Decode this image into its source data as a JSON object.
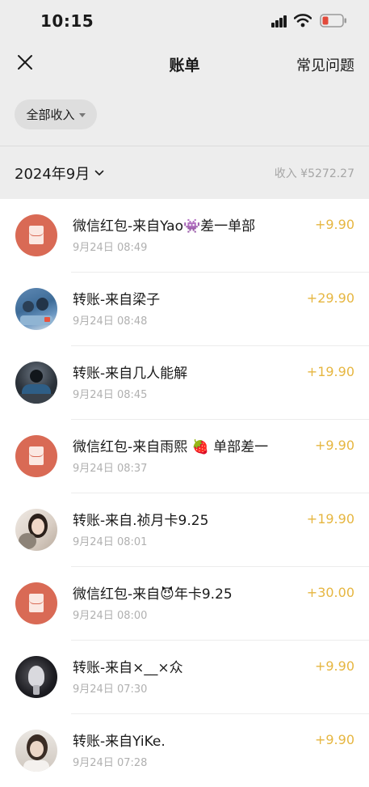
{
  "status_bar": {
    "time": "10:15"
  },
  "nav": {
    "title": "账单",
    "faq_label": "常见问题"
  },
  "filter": {
    "label": "全部收入"
  },
  "month": {
    "label": "2024年9月",
    "income_summary": "收入 ¥5272.27"
  },
  "transactions": [
    {
      "title": "微信红包-来自Yao👾差一单部",
      "time": "9月24日 08:49",
      "amount": "+9.90",
      "avatar": "red-packet-icon"
    },
    {
      "title": "转账-来自梁子",
      "time": "9月24日 08:48",
      "amount": "+29.90",
      "avatar": "user-avatar"
    },
    {
      "title": "转账-来自几人能解",
      "time": "9月24日 08:45",
      "amount": "+19.90",
      "avatar": "user-avatar"
    },
    {
      "title": "微信红包-来自雨熙 🍓 单部差一",
      "time": "9月24日 08:37",
      "amount": "+9.90",
      "avatar": "red-packet-icon"
    },
    {
      "title": "转账-来自.祯月卡9.25",
      "time": "9月24日 08:01",
      "amount": "+19.90",
      "avatar": "user-avatar"
    },
    {
      "title": "微信红包-来自😈年卡9.25",
      "time": "9月24日 08:00",
      "amount": "+30.00",
      "avatar": "red-packet-icon"
    },
    {
      "title": "转账-来自×__×众",
      "time": "9月24日 07:30",
      "amount": "+9.90",
      "avatar": "user-avatar"
    },
    {
      "title": "转账-来自YiKe.",
      "time": "9月24日 07:28",
      "amount": "+9.90",
      "avatar": "user-avatar"
    }
  ],
  "colors": {
    "amount": "#e6b640",
    "red_packet": "#d96a55",
    "background": "#ededed"
  }
}
